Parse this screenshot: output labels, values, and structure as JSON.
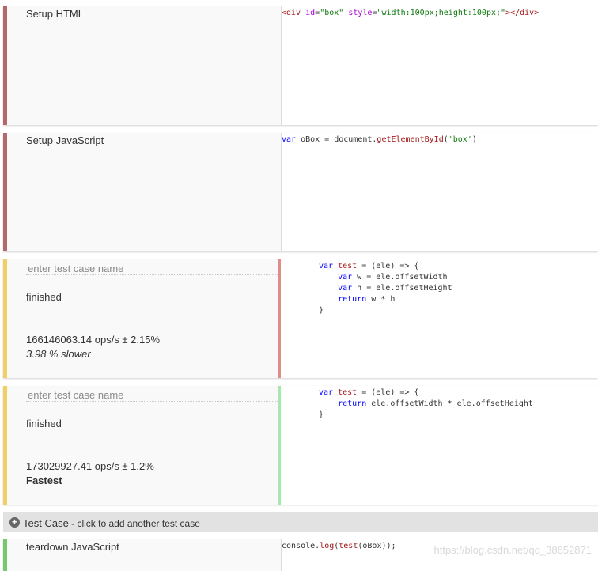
{
  "colors": {
    "setup_stripe": "#b46868",
    "testcase_stripe": "#f1d063",
    "teardown_stripe": "#76c96a",
    "slower_bar": "#e08c88",
    "fastest_bar": "#a9e8ad"
  },
  "setup_html": {
    "label": "Setup HTML",
    "code": "<div id=\"box\" style=\"width:100px;height:100px;\"></div>"
  },
  "setup_js": {
    "label": "Setup JavaScript",
    "code": "var oBox = document.getElementById('box')"
  },
  "test_cases": [
    {
      "name_placeholder": "enter test case name",
      "status": "finished",
      "ops": "166146063.14 ops/s ± 2.15%",
      "relative": "3.98 % slower",
      "code_lines": [
        "var test = (ele) => {",
        "    var w = ele.offsetWidth",
        "    var h = ele.offsetHeight",
        "    return w * h",
        "}"
      ]
    },
    {
      "name_placeholder": "enter test case name",
      "status": "finished",
      "ops": "173029927.41 ops/s ± 1.2%",
      "relative": "Fastest",
      "code_lines": [
        "var test = (ele) => {",
        "    return ele.offsetWidth * ele.offsetHeight",
        "}"
      ]
    }
  ],
  "add_test_case": {
    "icon": "plus-circle-icon",
    "label": "Test Case",
    "hint": " - click to add another test case"
  },
  "teardown": {
    "label": "teardown JavaScript",
    "code": "console.log(test(oBox));",
    "watermark": "https://blog.csdn.net/qq_38652871"
  }
}
